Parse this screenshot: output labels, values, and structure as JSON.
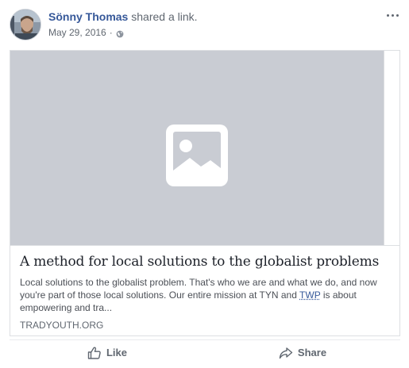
{
  "post": {
    "author_name": "Sönny Thomas",
    "action_text": " shared a link.",
    "date": "May 29, 2016",
    "separator": "·",
    "privacy_icon": "globe-icon",
    "menu_icon": "more-options-icon"
  },
  "link_card": {
    "image_placeholder_icon": "image-placeholder-icon",
    "title": "A method for local solutions to the globalist problems",
    "description_start": "Local solutions to the globalist problem. That's who we are and what we do, and now you're part of those local solutions. Our entire mission at TYN and ",
    "description_link": "TWP",
    "description_end": " is about empowering and tra...",
    "domain": "TRADYOUTH.ORG"
  },
  "actions": {
    "like_label": "Like",
    "share_label": "Share"
  },
  "colors": {
    "link_blue": "#365899",
    "meta_gray": "#606770",
    "placeholder_bg": "#c9ccd3",
    "border": "#dddfe2"
  }
}
